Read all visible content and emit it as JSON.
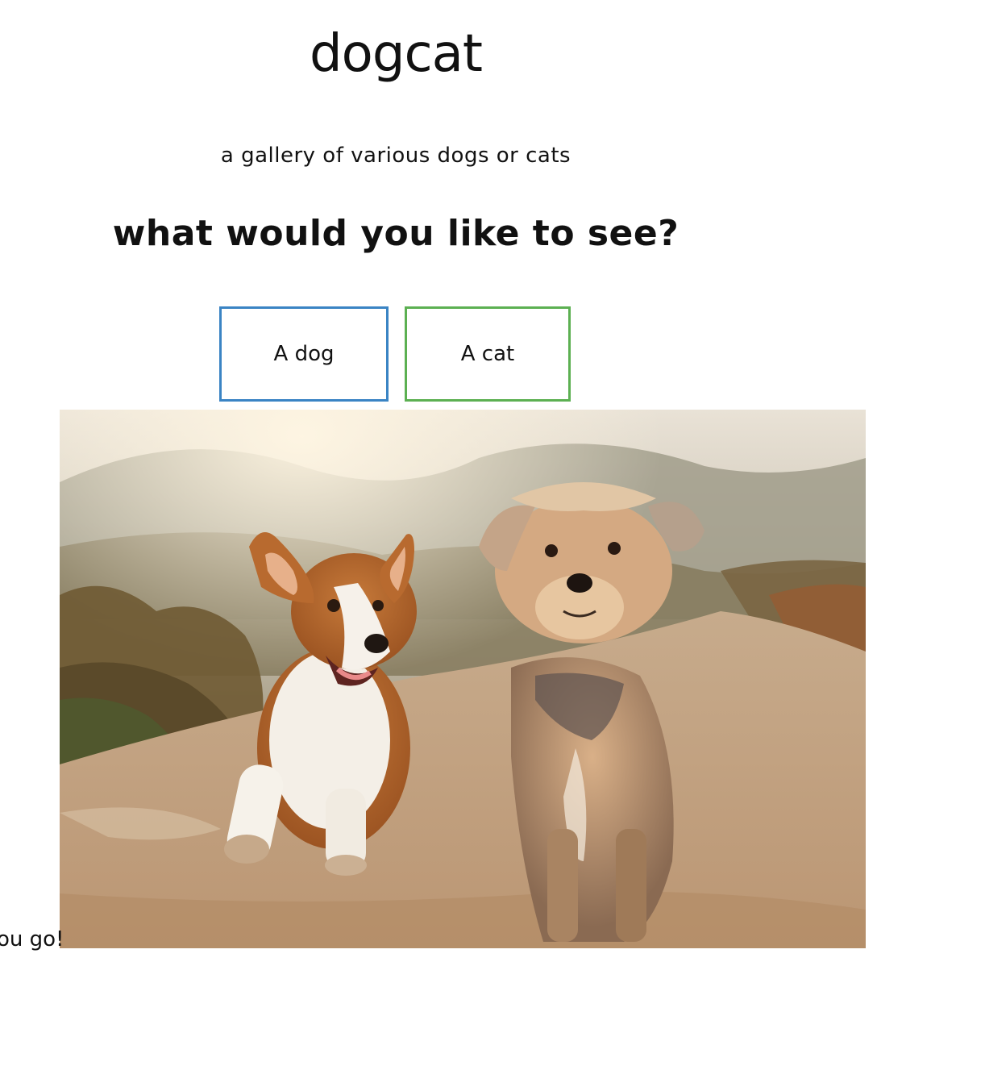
{
  "header": {
    "title": "dogcat",
    "subtitle": "a gallery of various dogs or cats"
  },
  "prompt": {
    "question": "what would you like to see?"
  },
  "buttons": {
    "dog_label": "A dog",
    "cat_label": "A cat",
    "dog_border_color": "#3a84c4",
    "cat_border_color": "#5cb052"
  },
  "gallery": {
    "caption_visible": "ou go!"
  }
}
